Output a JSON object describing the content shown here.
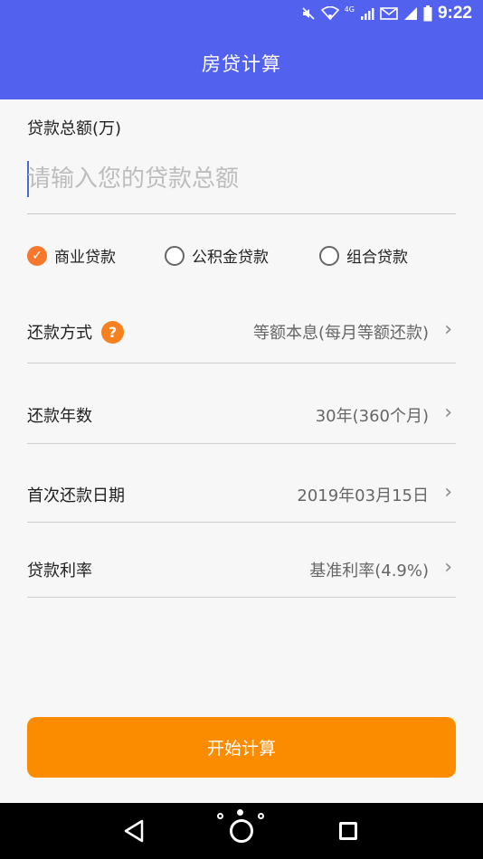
{
  "status": {
    "time": "9:22",
    "network": "4G",
    "icons": [
      "mute-icon",
      "wifi-icon",
      "signal-icon",
      "mail-icon",
      "battery-icon"
    ]
  },
  "header": {
    "title": "房贷计算"
  },
  "form": {
    "amount_label": "贷款总额(万)",
    "amount_placeholder": "请输入您的贷款总额",
    "amount_value": "",
    "loan_types": [
      {
        "label": "商业贷款",
        "checked": true
      },
      {
        "label": "公积金贷款",
        "checked": false
      },
      {
        "label": "组合贷款",
        "checked": false
      }
    ],
    "rows": [
      {
        "label": "还款方式",
        "value": "等额本息(每月等额还款)",
        "has_help": true,
        "help_glyph": "?"
      },
      {
        "label": "还款年数",
        "value": "30年(360个月)"
      },
      {
        "label": "首次还款日期",
        "value": "2019年03月15日"
      },
      {
        "label": "贷款利率",
        "value": "基准利率(4.9%)"
      }
    ],
    "chevron": "›",
    "check_glyph": "✓"
  },
  "actions": {
    "calculate_label": "开始计算"
  },
  "colors": {
    "appbar": "#5362ee",
    "accent_orange": "#fb8c00",
    "radio_checked": "#f5782c",
    "help_badge": "#f5821f",
    "background": "#f7f7f7"
  }
}
